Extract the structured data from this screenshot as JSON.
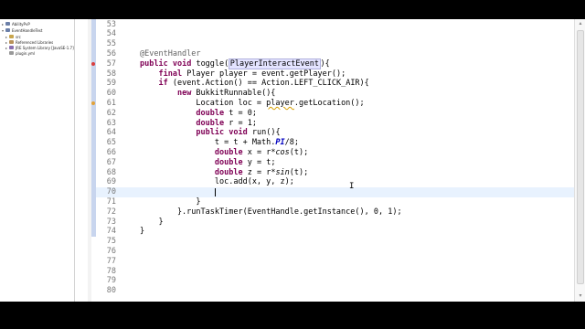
{
  "explorer": {
    "items": [
      {
        "label": "AbilityPvP",
        "arrow": "▸",
        "icon_color": "#6b7fa8"
      },
      {
        "label": "EventHandleTest",
        "arrow": "▾",
        "icon_color": "#6b7fa8"
      },
      {
        "label": "src",
        "arrow": "▸",
        "icon_color": "#c9a64d"
      },
      {
        "label": "Referenced Libraries",
        "arrow": "▸",
        "icon_color": "#b8925a"
      },
      {
        "label": "JRE System Library [JavaSE-1.7]",
        "arrow": "▸",
        "icon_color": "#8a6fb0"
      },
      {
        "label": "plugin.yml",
        "arrow": "",
        "icon_color": "#999999"
      }
    ]
  },
  "editor": {
    "line_numbers": [
      "53",
      "54",
      "55",
      "56",
      "57",
      "58",
      "59",
      "60",
      "61",
      "62",
      "63",
      "64",
      "65",
      "66",
      "67",
      "68",
      "69",
      "70",
      "71",
      "72",
      "73",
      "74",
      "75",
      "76",
      "77",
      "78",
      "79",
      "80"
    ],
    "lines": [
      [],
      [],
      [],
      [
        {
          "t": "@EventHandler",
          "c": "ann"
        }
      ],
      [
        {
          "t": "public",
          "c": "kw"
        },
        {
          "t": " "
        },
        {
          "t": "void",
          "c": "kw"
        },
        {
          "t": " toggle("
        },
        {
          "t": "PlayerInteractEvent",
          "c": "hl"
        },
        {
          "t": "){"
        }
      ],
      [
        {
          "t": "    "
        },
        {
          "t": "final",
          "c": "kw"
        },
        {
          "t": " Player player = event.getPlayer();"
        }
      ],
      [
        {
          "t": "    "
        },
        {
          "t": "if",
          "c": "kw"
        },
        {
          "t": " (event.Action() == Action.LEFT_CLICK_AIR){"
        }
      ],
      [
        {
          "t": "        "
        },
        {
          "t": "new",
          "c": "kw"
        },
        {
          "t": " BukkitRunnable(){"
        }
      ],
      [
        {
          "t": "            Location loc = "
        },
        {
          "t": "player",
          "c": "warn"
        },
        {
          "t": ".getLocation();"
        }
      ],
      [
        {
          "t": "            "
        },
        {
          "t": "double",
          "c": "kw"
        },
        {
          "t": " t = 0;"
        }
      ],
      [
        {
          "t": "            "
        },
        {
          "t": "double",
          "c": "kw"
        },
        {
          "t": " r = 1;"
        }
      ],
      [
        {
          "t": "            "
        },
        {
          "t": "public",
          "c": "kw"
        },
        {
          "t": " "
        },
        {
          "t": "void",
          "c": "kw"
        },
        {
          "t": " run(){"
        }
      ],
      [
        {
          "t": "                t = t + Math."
        },
        {
          "t": "PI",
          "c": "fld"
        },
        {
          "t": "/8;"
        }
      ],
      [
        {
          "t": "                "
        },
        {
          "t": "double",
          "c": "kw"
        },
        {
          "t": " x = r*"
        },
        {
          "t": "cos",
          "c": "sm"
        },
        {
          "t": "(t);"
        }
      ],
      [
        {
          "t": "                "
        },
        {
          "t": "double",
          "c": "kw"
        },
        {
          "t": " y = t;"
        }
      ],
      [
        {
          "t": "                "
        },
        {
          "t": "double",
          "c": "kw"
        },
        {
          "t": " z = r*"
        },
        {
          "t": "sin",
          "c": "sm"
        },
        {
          "t": "(t);"
        }
      ],
      [
        {
          "t": "                loc.add(x, y, z);"
        }
      ],
      [],
      [
        {
          "t": "            }"
        }
      ],
      [
        {
          "t": "        }.runTaskTimer(EventHandle.getInstance(), 0, 1);"
        }
      ],
      [
        {
          "t": "    }"
        }
      ],
      [
        {
          "t": "}"
        }
      ],
      [],
      [],
      [],
      [],
      [],
      []
    ],
    "current_line": "70",
    "markers": {
      "breakpoint_line": "57",
      "warning_line": "61"
    }
  },
  "pointer_glyph": "I",
  "colors": {
    "keyword": "#7f0055",
    "annotation": "#646464",
    "field": "#0000c0",
    "current_line": "#e8f2fe"
  }
}
